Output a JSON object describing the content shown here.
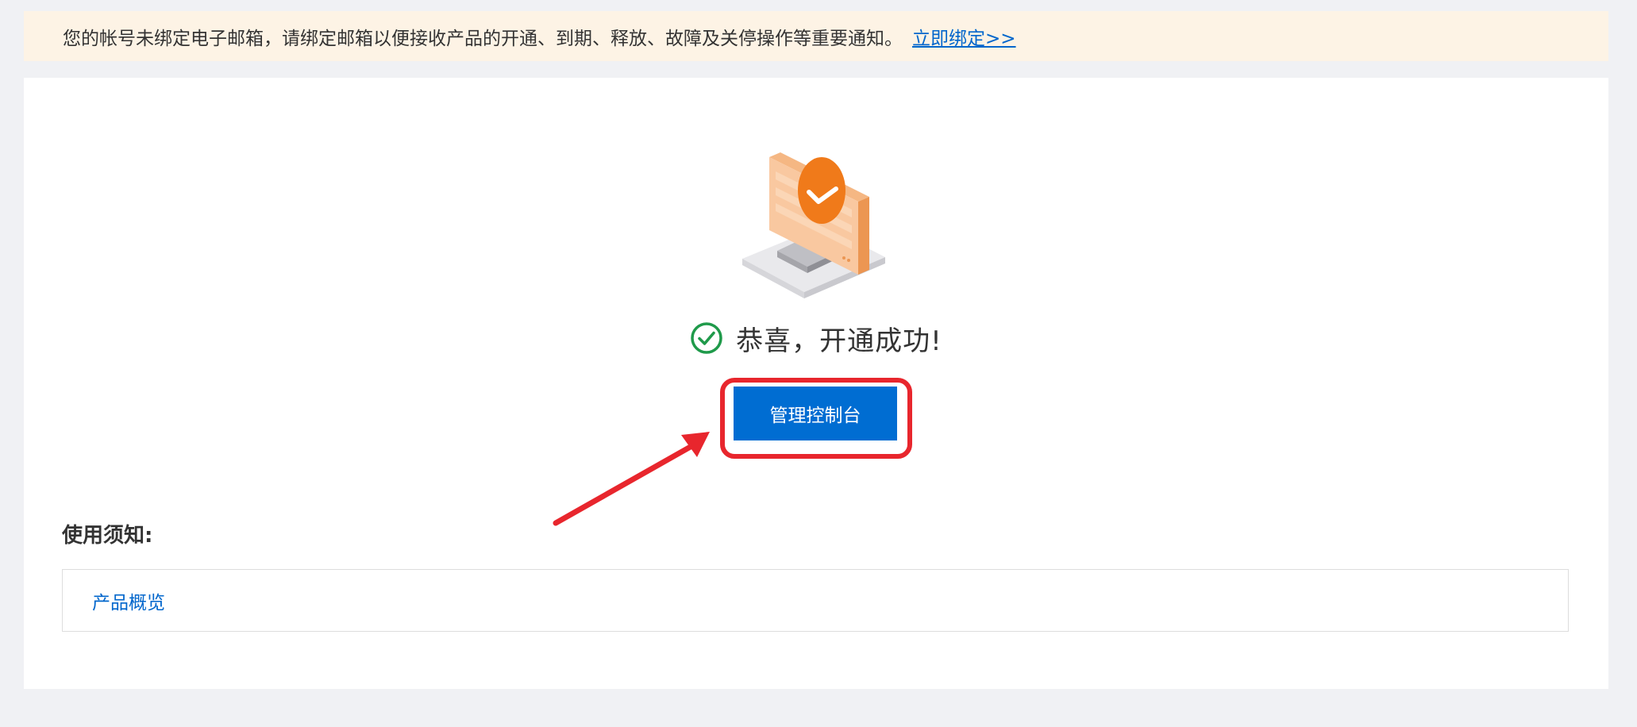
{
  "notice": {
    "message": "您的帐号未绑定电子邮箱，请绑定邮箱以便接收产品的开通、到期、释放、故障及关停操作等重要通知。",
    "link_label": "立即绑定>>"
  },
  "illustration": {
    "icon": "monitor-success-icon",
    "accent_color": "#f07a1a"
  },
  "success": {
    "icon": "check-circle-icon",
    "icon_color": "#1f9a4a",
    "message": "恭喜，开通成功!"
  },
  "actions": {
    "console_label": "管理控制台",
    "button_color": "#006dd2",
    "highlight_color": "#e8262d"
  },
  "notes": {
    "title": "使用须知:",
    "link_label": "产品概览"
  }
}
